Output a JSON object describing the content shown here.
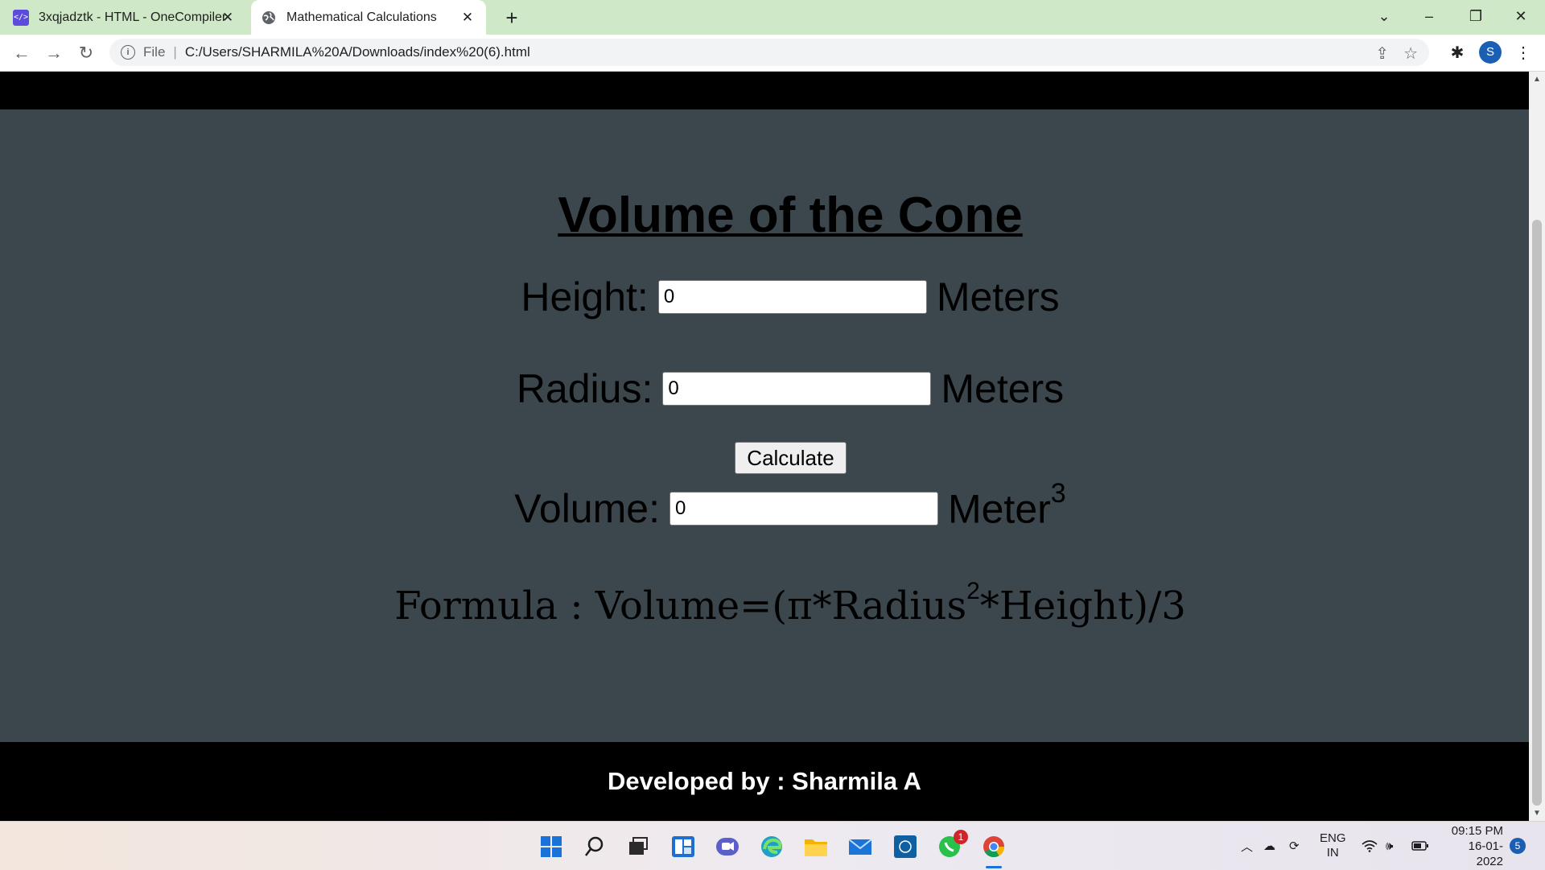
{
  "browser": {
    "tabs": [
      {
        "title": "3xqjadztk - HTML - OneCompiler",
        "icon": "onecompiler-icon"
      },
      {
        "title": "Mathematical Calculations",
        "icon": "globe-icon"
      }
    ],
    "address": {
      "scheme_label": "File",
      "url": "C:/Users/SHARMILA%20A/Downloads/index%20(6).html"
    },
    "profile_initial": "S"
  },
  "page": {
    "title": "Volume of the Cone",
    "height": {
      "label": "Height:",
      "value": "0",
      "unit": "Meters"
    },
    "radius": {
      "label": "Radius:",
      "value": "0",
      "unit": "Meters"
    },
    "calculate_label": "Calculate",
    "volume": {
      "label": "Volume:",
      "value": "0",
      "unit": "Meter",
      "unit_exponent": "3"
    },
    "formula": {
      "prefix": "Formula : Volume=(π*Radius",
      "exponent": "2",
      "suffix": "*Height)/3"
    },
    "footer": "Developed by : Sharmila A",
    "colors": {
      "background": "#3c474d",
      "header_footer": "#000000",
      "footer_text": "#ffffff"
    }
  },
  "taskbar": {
    "whatsapp_badge": "1",
    "language": "ENG",
    "region": "IN",
    "time": "09:15 PM",
    "date": "16-01-2022",
    "notifications": "5"
  }
}
